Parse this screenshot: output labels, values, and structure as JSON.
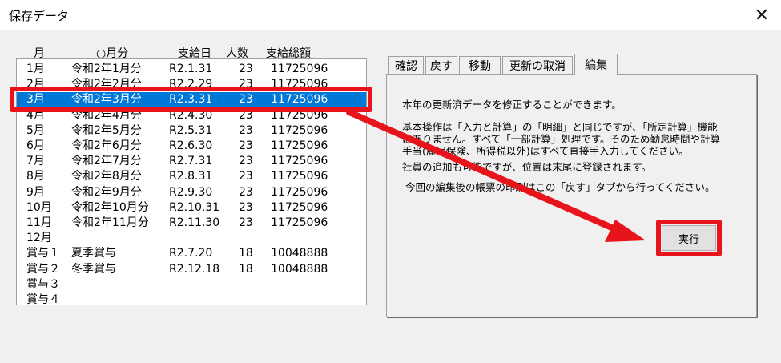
{
  "window": {
    "title": "保存データ",
    "close_glyph": "✕"
  },
  "list": {
    "headers": [
      "月",
      "○月分",
      "支給日",
      "人数",
      "支給総額"
    ],
    "rows": [
      [
        "1月",
        "令和2年1月分",
        "R2.1.31",
        "23",
        "11725096"
      ],
      [
        "2月",
        "令和2年2月分",
        "R2.2.29",
        "23",
        "11725096"
      ],
      [
        "3月",
        "令和2年3月分",
        "R2.3.31",
        "23",
        "11725096"
      ],
      [
        "4月",
        "令和2年4月分",
        "R2.4.30",
        "23",
        "11725096"
      ],
      [
        "5月",
        "令和2年5月分",
        "R2.5.31",
        "23",
        "11725096"
      ],
      [
        "6月",
        "令和2年6月分",
        "R2.6.30",
        "23",
        "11725096"
      ],
      [
        "7月",
        "令和2年7月分",
        "R2.7.31",
        "23",
        "11725096"
      ],
      [
        "8月",
        "令和2年8月分",
        "R2.8.31",
        "23",
        "11725096"
      ],
      [
        "9月",
        "令和2年9月分",
        "R2.9.30",
        "23",
        "11725096"
      ],
      [
        "10月",
        "令和2年10月分",
        "R2.10.31",
        "23",
        "11725096"
      ],
      [
        "11月",
        "令和2年11月分",
        "R2.11.30",
        "23",
        "11725096"
      ],
      [
        "12月",
        "",
        "",
        "",
        ""
      ],
      [
        "賞与１",
        "夏季賞与",
        "R2.7.20",
        "18",
        "10048888"
      ],
      [
        "賞与２",
        "冬季賞与",
        "R2.12.18",
        "18",
        "10048888"
      ],
      [
        "賞与３",
        "",
        "",
        "",
        ""
      ],
      [
        "賞与４",
        "",
        "",
        "",
        ""
      ]
    ],
    "selected_row": "3月"
  },
  "tabs": [
    "確認",
    "戻す",
    "移動",
    "更新の取消",
    "編集"
  ],
  "active_tab": "編集",
  "panel": {
    "line1": "本年の更新済データを修正することができます。",
    "line2a": "基本操作は「入力と計算」の「明細」と同じですが、「所定計算」機能",
    "line2b": "はありません。すべて「一部計算」処理です。そのため勤怠時間や計算",
    "line2c": "手当(雇用保険、所得税以外)はすべて直接手入力してください。",
    "line3": "社員の追加も可能ですが、位置は末尾に登録されます。",
    "line4": "今回の編集後の帳票の印刷はこの「戻す」タブから行ってください。",
    "execute_label": "実行"
  },
  "colors": {
    "selection": "#0078d7",
    "annotation": "#e8141c"
  }
}
